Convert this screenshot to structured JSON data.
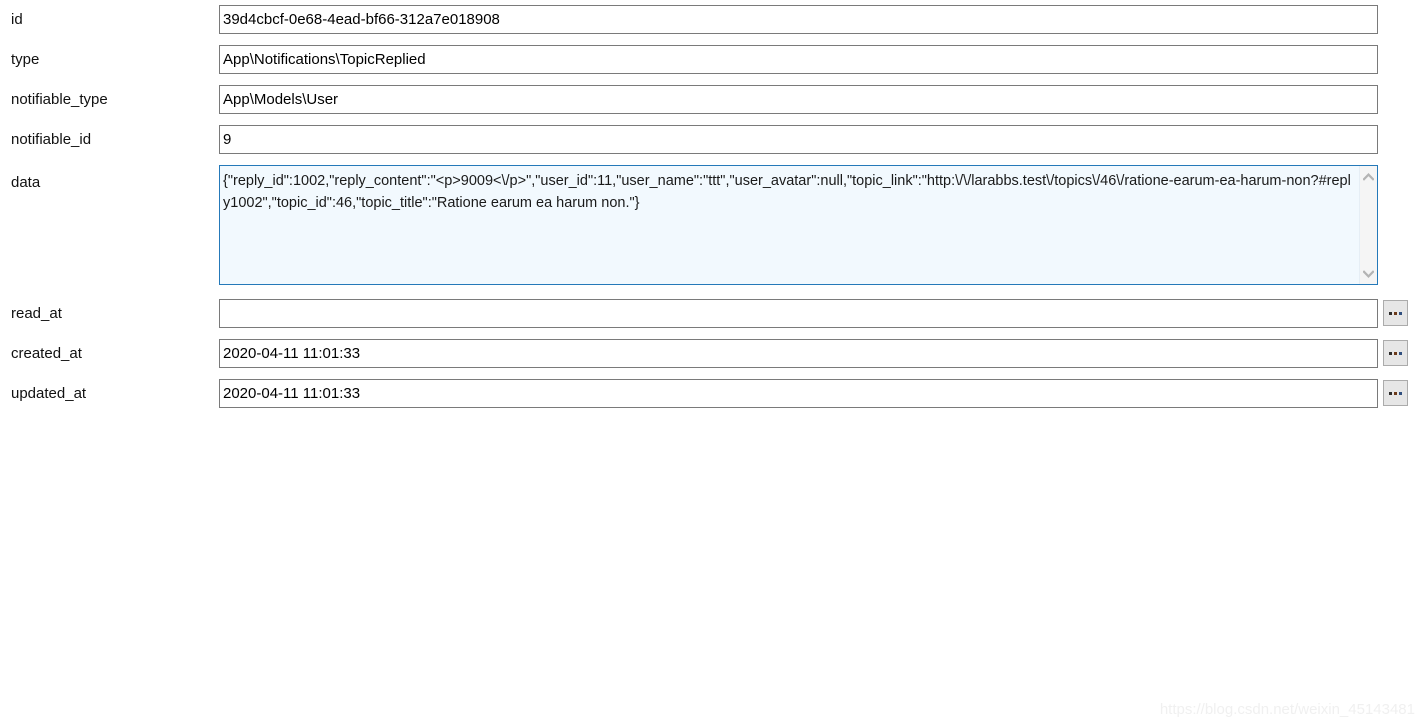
{
  "form": {
    "fields": [
      {
        "label": "id",
        "value": "39d4cbcf-0e68-4ead-bf66-312a7e018908",
        "type": "text",
        "name": "id",
        "has_picker": false
      },
      {
        "label": "type",
        "value": "App\\Notifications\\TopicReplied",
        "type": "text",
        "name": "type",
        "has_picker": false
      },
      {
        "label": "notifiable_type",
        "value": "App\\Models\\User",
        "type": "text",
        "name": "notifiable-type",
        "has_picker": false
      },
      {
        "label": "notifiable_id",
        "value": "9",
        "type": "text",
        "name": "notifiable-id",
        "has_picker": false
      },
      {
        "label": "data",
        "value": "{\"reply_id\":1002,\"reply_content\":\"<p>9009<\\/p>\",\"user_id\":11,\"user_name\":\"ttt\",\"user_avatar\":null,\"topic_link\":\"http:\\/\\/larabbs.test\\/topics\\/46\\/ratione-earum-ea-harum-non?#reply1002\",\"topic_id\":46,\"topic_title\":\"Ratione earum ea harum non.\"}",
        "type": "textarea",
        "name": "data",
        "has_picker": false
      },
      {
        "label": "read_at",
        "value": "",
        "type": "text",
        "name": "read-at",
        "has_picker": true
      },
      {
        "label": "created_at",
        "value": "2020-04-11 11:01:33",
        "type": "text",
        "name": "created-at",
        "has_picker": true
      },
      {
        "label": "updated_at",
        "value": "2020-04-11 11:01:33",
        "type": "text",
        "name": "updated-at",
        "has_picker": true
      }
    ],
    "picker_button_label": "...",
    "scrollbar": {
      "up_icon": "chevron-up-icon",
      "down_icon": "chevron-down-icon"
    }
  },
  "watermark": {
    "text": "https://blog.csdn.net/weixin_45143481"
  },
  "colors": {
    "focus_border": "#2579b9",
    "focus_background": "#f2f9fe",
    "input_border": "#7a7a7a",
    "button_face": "#e6e6e6"
  }
}
